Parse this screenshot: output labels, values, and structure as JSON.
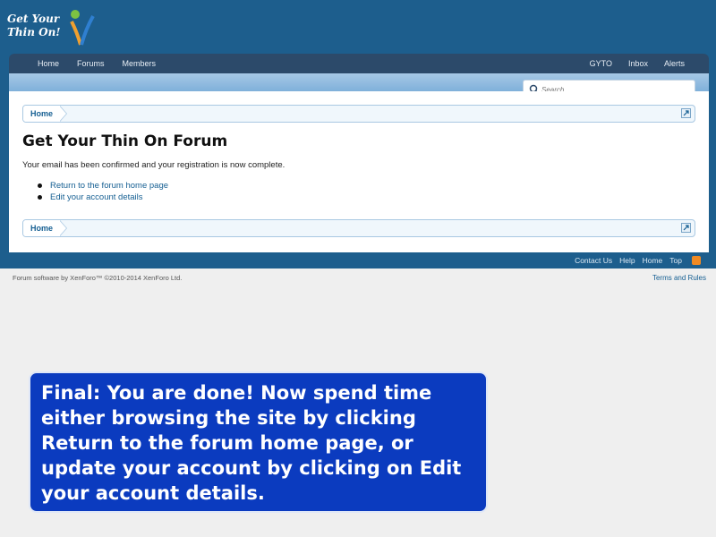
{
  "logo": {
    "text": "Get Your\nThin On!"
  },
  "nav": {
    "left": [
      "Home",
      "Forums",
      "Members"
    ],
    "right": [
      "GYTO",
      "Inbox",
      "Alerts"
    ]
  },
  "search": {
    "placeholder": "Search..."
  },
  "breadcrumb": {
    "home": "Home"
  },
  "page": {
    "title": "Get Your Thin On Forum",
    "message": "Your email has been confirmed and your registration is now complete.",
    "links": [
      "Return to the forum home page",
      "Edit your account details"
    ]
  },
  "footer": {
    "links": [
      "Contact Us",
      "Help",
      "Home",
      "Top"
    ],
    "copyright": "Forum software by XenForo™ ©2010-2014 XenForo Ltd.",
    "terms": "Terms and Rules"
  },
  "callout": {
    "text": "Final:  You are done!  Now spend time\neither browsing the site by clicking\nReturn to the forum home page, or\nupdate your account by clicking on Edit\nyour account details."
  },
  "colors": {
    "header": "#1d5e8d",
    "nav": "#2c4a6a",
    "link": "#176093",
    "callout": "#0b3bbf"
  }
}
